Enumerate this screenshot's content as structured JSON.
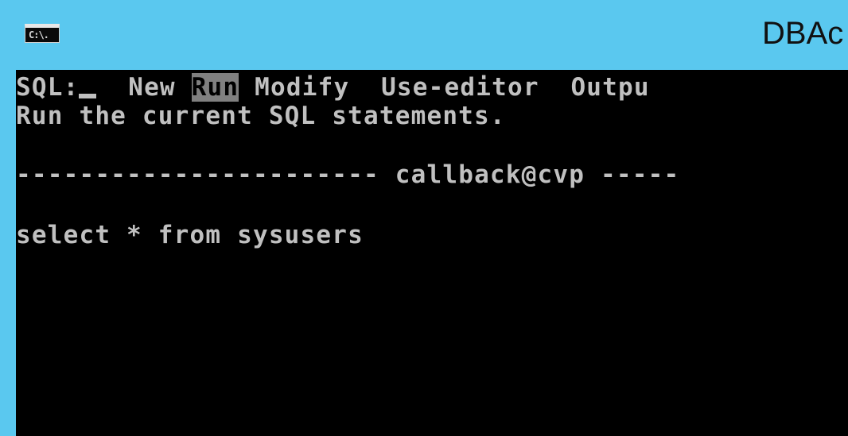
{
  "window": {
    "title": "DBAc",
    "icon": "cmd-icon",
    "icon_label": "C:\\."
  },
  "menu": {
    "prompt": "SQL:",
    "items": [
      {
        "label": "New",
        "selected": false
      },
      {
        "label": "Run",
        "selected": true
      },
      {
        "label": "Modify",
        "selected": false
      },
      {
        "label": "Use-editor",
        "selected": false
      },
      {
        "label": "Outpu",
        "selected": false
      }
    ],
    "description": "Run the current SQL statements."
  },
  "separator": {
    "left": "-----------------------",
    "label": "callback@cvp",
    "right": "-----"
  },
  "editor": {
    "statement": "select * from sysusers"
  },
  "colors": {
    "titlebar": "#5ac8ef",
    "console_bg": "#000000",
    "console_text": "#c0c0c0",
    "highlight_bg": "#808080"
  }
}
